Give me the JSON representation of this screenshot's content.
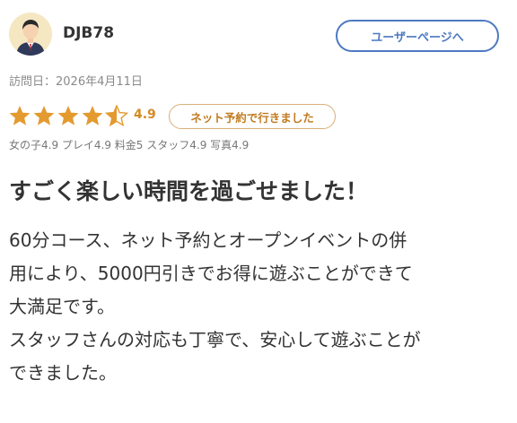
{
  "user": {
    "name": "DJB78",
    "user_page_label": "ユーザーページへ"
  },
  "visit": {
    "date_label": "訪問日：2026年4月11日"
  },
  "rating": {
    "overall": 4.9,
    "overall_label": "4.9",
    "max": 5,
    "star_color": "#e39a2f",
    "empty_color": "#dcdcdc",
    "badge_label": "ネット予約で行きました"
  },
  "sub_ratings": {
    "text": "女の子4.9 プレイ4.9 料金5 スタッフ4.9 写真4.9"
  },
  "review": {
    "title": "すごく楽しい時間を過ごせました！",
    "lines": [
      "60分コース、ネット予約とオープンイベントの併",
      "用により、5000円引きでお得に遊ぶことができて",
      "大満足です。",
      "スタッフさんの対応も丁寧で、安心して遊ぶことが",
      "できました。"
    ]
  }
}
